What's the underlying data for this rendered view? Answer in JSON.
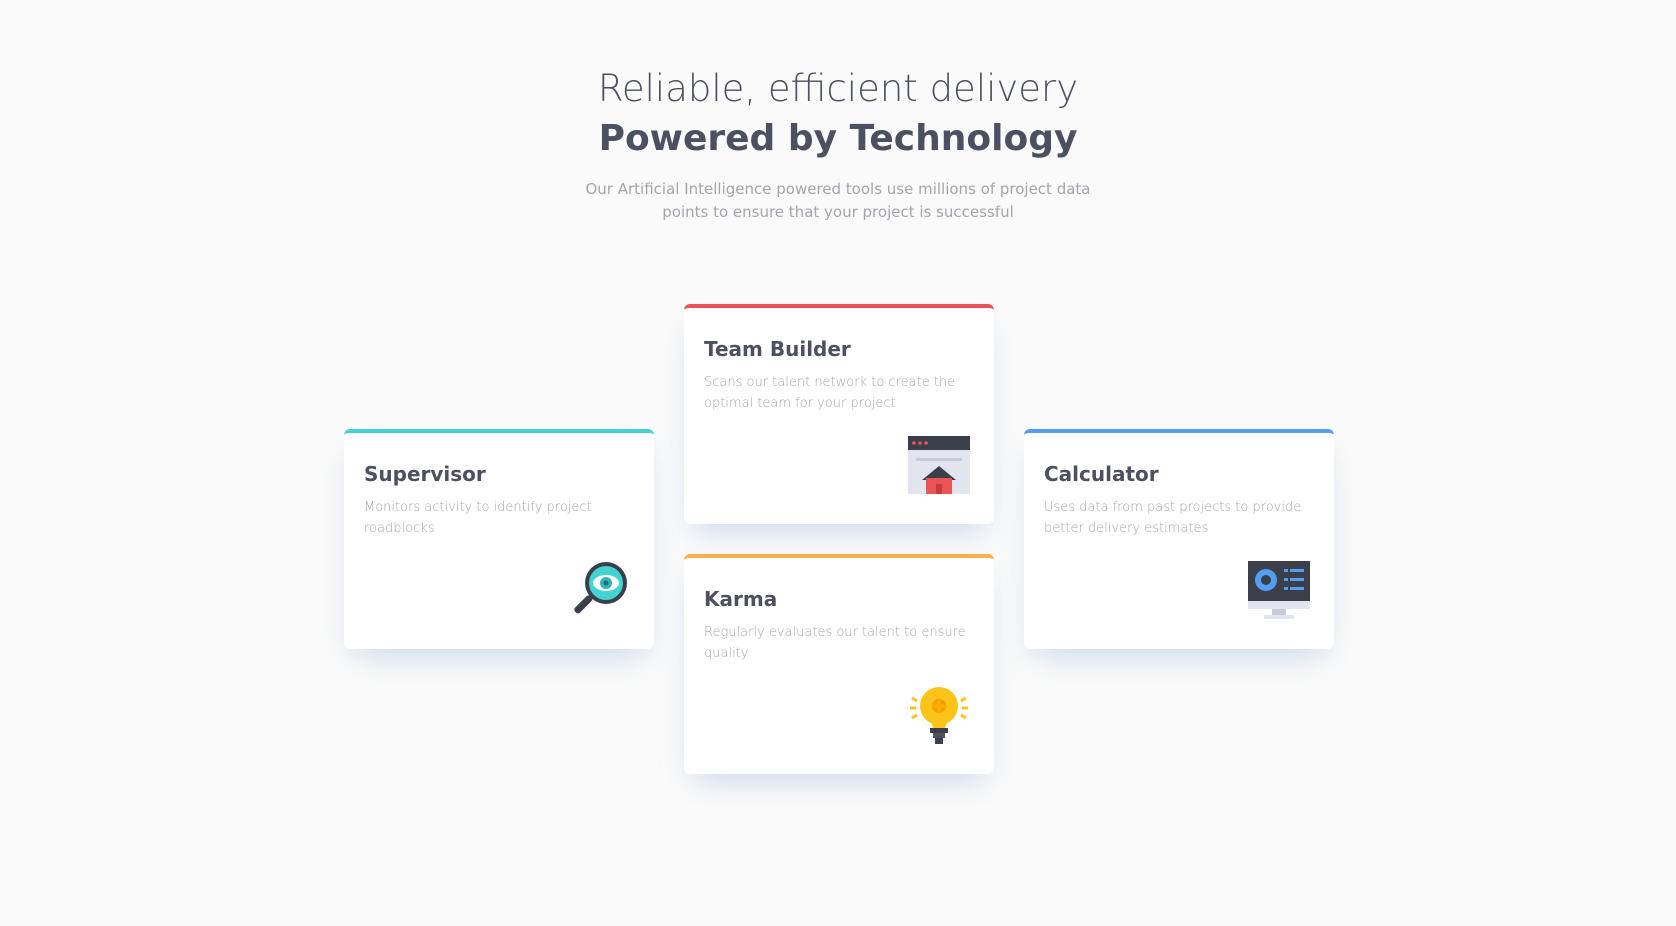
{
  "header": {
    "line1": "Reliable, efficient delivery",
    "line2": "Powered by Technology",
    "description": "Our Artificial Intelligence powered tools use millions of project data points to ensure that your project is successful"
  },
  "cards": {
    "supervisor": {
      "title": "Supervisor",
      "description": "Monitors activity to identify project roadblocks",
      "icon": "magnifier-eye-icon",
      "accent": "#44d3d2"
    },
    "team_builder": {
      "title": "Team Builder",
      "description": "Scans our talent network to create the optimal team for your project",
      "icon": "browser-home-icon",
      "accent": "#ea5454"
    },
    "karma": {
      "title": "Karma",
      "description": "Regularly evaluates our talent to ensure quality",
      "icon": "lightbulb-icon",
      "accent": "#fcaf4a"
    },
    "calculator": {
      "title": "Calculator",
      "description": "Uses data from past projects to provide better delivery estimates",
      "icon": "monitor-dashboard-icon",
      "accent": "#549ef2"
    }
  },
  "colors": {
    "background": "#fafafa",
    "heading": "#4d5060",
    "text_muted": "#a3a5ae"
  }
}
